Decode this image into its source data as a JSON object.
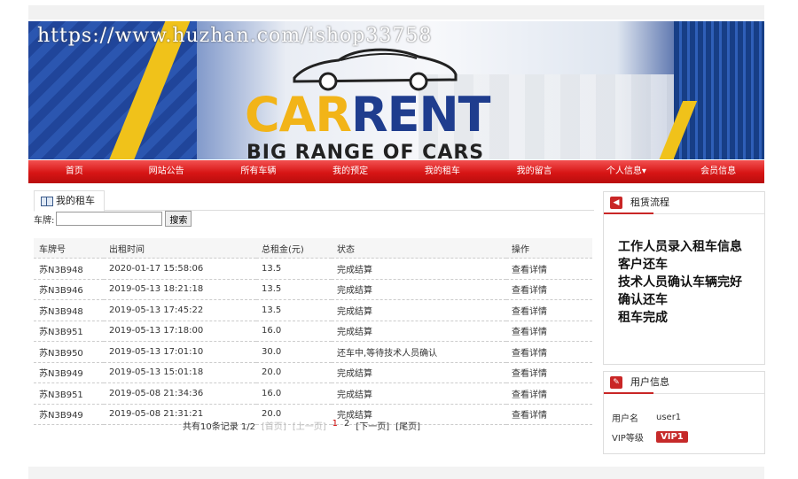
{
  "banner": {
    "watermark": "https://www.huzhan.com/ishop33758",
    "logo_part1": "CAR",
    "logo_part2": "RENT",
    "tagline": "BIG RANGE OF CARS"
  },
  "nav": [
    "首页",
    "网站公告",
    "所有车辆",
    "我的预定",
    "我的租车",
    "我的留言",
    "个人信息▾",
    "会员信息"
  ],
  "main": {
    "title": "我的租车",
    "search_label": "车牌:",
    "search_value": "",
    "search_button": "搜索",
    "columns": [
      "车牌号",
      "出租时间",
      "总租金(元)",
      "状态",
      "操作"
    ],
    "rows": [
      [
        "苏N3B948",
        "2020-01-17 15:58:06",
        "13.5",
        "完成结算",
        "查看详情"
      ],
      [
        "苏N3B946",
        "2019-05-13 18:21:18",
        "13.5",
        "完成结算",
        "查看详情"
      ],
      [
        "苏N3B948",
        "2019-05-13 17:45:22",
        "13.5",
        "完成结算",
        "查看详情"
      ],
      [
        "苏N3B951",
        "2019-05-13 17:18:00",
        "16.0",
        "完成结算",
        "查看详情"
      ],
      [
        "苏N3B950",
        "2019-05-13 17:01:10",
        "30.0",
        "还车中,等待技术人员确认",
        "查看详情"
      ],
      [
        "苏N3B949",
        "2019-05-13 15:01:18",
        "20.0",
        "完成结算",
        "查看详情"
      ],
      [
        "苏N3B951",
        "2019-05-08 21:34:36",
        "16.0",
        "完成结算",
        "查看详情"
      ],
      [
        "苏N3B949",
        "2019-05-08 21:31:21",
        "20.0",
        "完成结算",
        "查看详情"
      ]
    ],
    "pager": {
      "summary": "共有10条记录 1/2",
      "first": "[首页]",
      "prev": "[上一页]",
      "page1": "1",
      "page2": "2",
      "next": "[下一页]",
      "last": "[尾页]"
    }
  },
  "side": {
    "process_title": "租赁流程",
    "process_steps": [
      "工作人员录入租车信息",
      "客户还车",
      "技术人员确认车辆完好",
      "确认还车",
      "租车完成"
    ],
    "user_title": "用户信息",
    "username_label": "用户名",
    "username_value": "user1",
    "vip_label": "VIP等级",
    "vip_value": "VIP1"
  },
  "colors": {
    "nav_red": "#d71515",
    "accent_yellow": "#f2b418",
    "accent_blue": "#1f3d8e",
    "vip_red": "#c62a2a"
  }
}
